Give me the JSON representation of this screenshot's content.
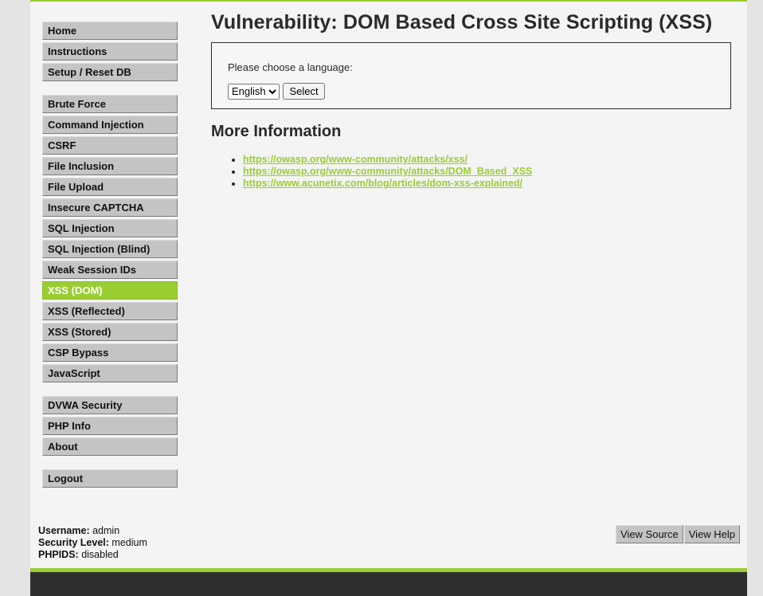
{
  "menu": {
    "group1": [
      {
        "label": "Home"
      },
      {
        "label": "Instructions"
      },
      {
        "label": "Setup / Reset DB"
      }
    ],
    "group2": [
      {
        "label": "Brute Force"
      },
      {
        "label": "Command Injection"
      },
      {
        "label": "CSRF"
      },
      {
        "label": "File Inclusion"
      },
      {
        "label": "File Upload"
      },
      {
        "label": "Insecure CAPTCHA"
      },
      {
        "label": "SQL Injection"
      },
      {
        "label": "SQL Injection (Blind)"
      },
      {
        "label": "Weak Session IDs"
      },
      {
        "label": "XSS (DOM)"
      },
      {
        "label": "XSS (Reflected)"
      },
      {
        "label": "XSS (Stored)"
      },
      {
        "label": "CSP Bypass"
      },
      {
        "label": "JavaScript"
      }
    ],
    "group3": [
      {
        "label": "DVWA Security"
      },
      {
        "label": "PHP Info"
      },
      {
        "label": "About"
      }
    ],
    "group4": [
      {
        "label": "Logout"
      }
    ],
    "selected": "XSS (DOM)"
  },
  "page": {
    "title": "Vulnerability: DOM Based Cross Site Scripting (XSS)",
    "prompt": "Please choose a language:",
    "language_selected": "English",
    "select_button": "Select",
    "more_info_heading": "More Information",
    "links": [
      "https://owasp.org/www-community/attacks/xss/",
      "https://owasp.org/www-community/attacks/DOM_Based_XSS",
      "https://www.acunetix.com/blog/articles/dom-xss-explained/"
    ]
  },
  "system_info": {
    "username_label": "Username:",
    "username": "admin",
    "security_label": "Security Level:",
    "security": "medium",
    "phpids_label": "PHPIDS:",
    "phpids": "disabled"
  },
  "footer_buttons": {
    "view_source": "View Source",
    "view_help": "View Help"
  },
  "colors": {
    "accent": "#9acd32",
    "menu_bg": "#c4c4c4",
    "footer_bg": "#2e2e2e"
  }
}
